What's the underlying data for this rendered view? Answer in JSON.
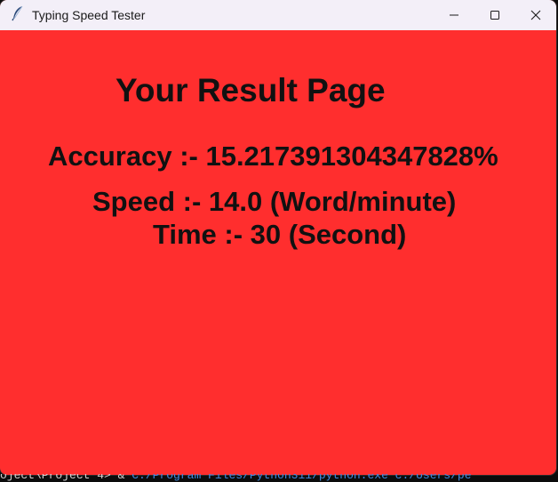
{
  "window": {
    "title": "Typing Speed Tester",
    "app_icon": "feather-icon",
    "controls": [
      "minimize-icon",
      "maximize-icon",
      "close-icon"
    ]
  },
  "content": {
    "heading": "Your Result Page",
    "accuracy": "Accuracy :- 15.217391304347828%",
    "speed": "Speed :- 14.0 (Word/minute)",
    "time": "Time :- 30 (Second)"
  },
  "terminal": {
    "prompt": "oject\\Project 4> & ",
    "command": "C:/Program Files/Python311/python.exe  c:/Users/pe"
  },
  "colors": {
    "background": "#ff2e2e",
    "text": "#111111",
    "titlebar": "#f3eff8"
  }
}
